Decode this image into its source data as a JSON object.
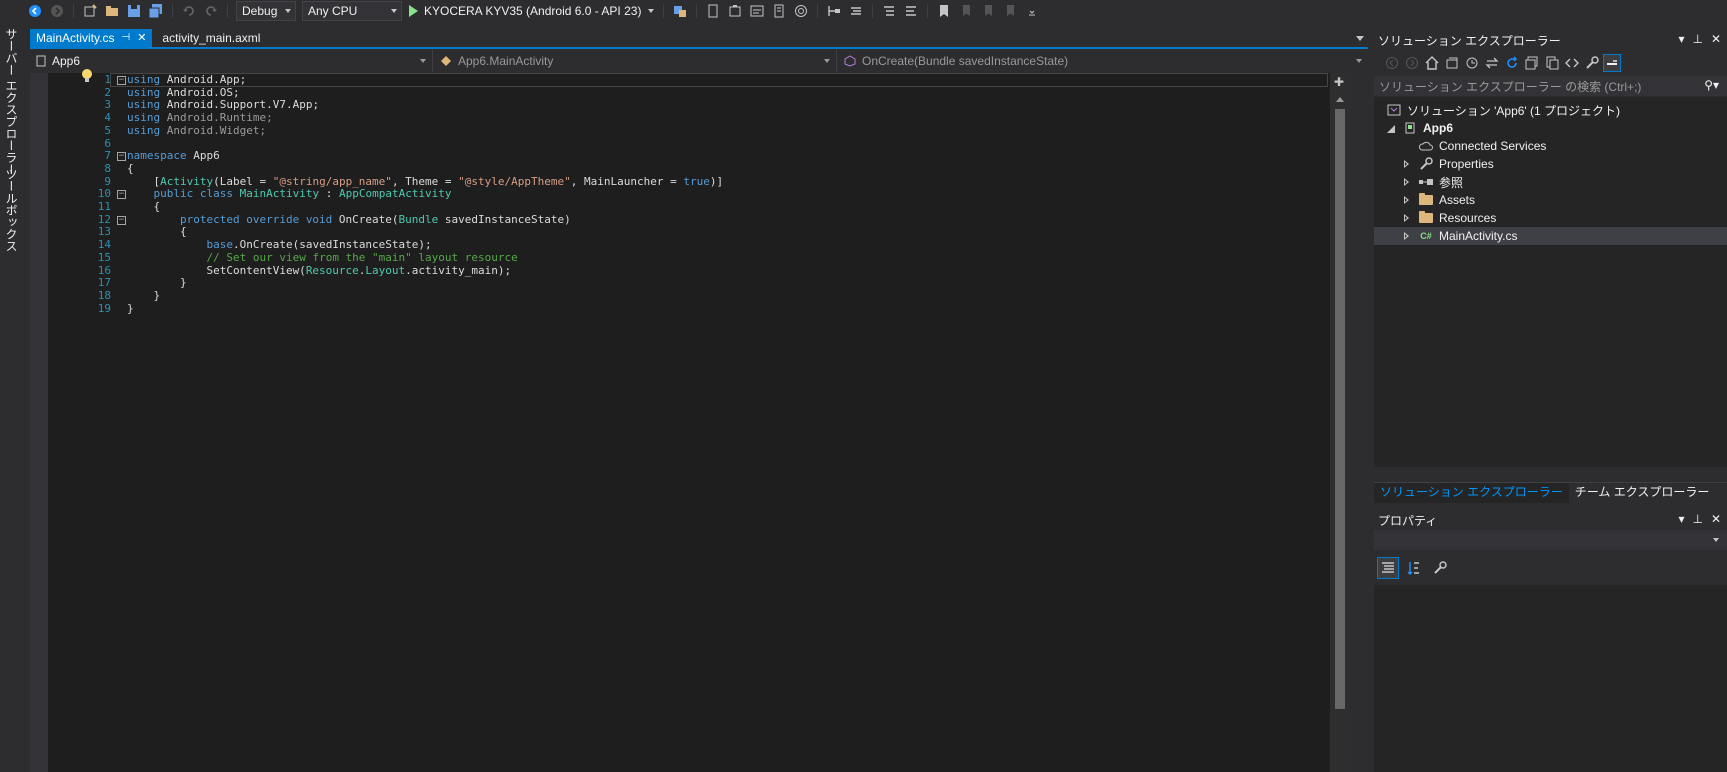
{
  "toolbar": {
    "configuration": "Debug",
    "platform": "Any CPU",
    "run_target": "KYOCERA KYV35 (Android 6.0 - API 23)"
  },
  "left_strip": {
    "server_explorer": "サーバー エクスプローラー",
    "toolbox": "ツールボックス"
  },
  "doc_tabs": {
    "active": "MainActivity.cs",
    "inactive": "activity_main.axml",
    "pin_glyph": "⊣",
    "close_glyph": "✕"
  },
  "nav_bar": {
    "project": "App6",
    "class": "App6.MainActivity",
    "member": "OnCreate(Bundle savedInstanceState)"
  },
  "code": {
    "lines": [
      {
        "n": "1",
        "fold": "−"
      },
      {
        "n": "2"
      },
      {
        "n": "3"
      },
      {
        "n": "4"
      },
      {
        "n": "5"
      },
      {
        "n": "6"
      },
      {
        "n": "7",
        "fold": "−"
      },
      {
        "n": "8"
      },
      {
        "n": "9"
      },
      {
        "n": "10",
        "fold": "−"
      },
      {
        "n": "11"
      },
      {
        "n": "12",
        "fold": "−"
      },
      {
        "n": "13"
      },
      {
        "n": "14"
      },
      {
        "n": "15"
      },
      {
        "n": "16"
      },
      {
        "n": "17"
      },
      {
        "n": "18"
      },
      {
        "n": "19"
      }
    ],
    "tokens": {
      "l1": [
        [
          "kw",
          "using"
        ],
        [
          "",
          " Android.App;"
        ]
      ],
      "l2": [
        [
          "kw",
          "using"
        ],
        [
          "",
          " Android.OS;"
        ]
      ],
      "l3": [
        [
          "kw",
          "using"
        ],
        [
          "",
          " Android.Support.V7.App;"
        ]
      ],
      "l4": [
        [
          "kw",
          "using"
        ],
        [
          "dim",
          " Android.Runtime;"
        ]
      ],
      "l5": [
        [
          "kw",
          "using"
        ],
        [
          "dim",
          " Android.Widget;"
        ]
      ],
      "l7": [
        [
          "kw",
          "namespace"
        ],
        [
          "",
          " App6"
        ]
      ],
      "l8": [
        [
          "",
          "{"
        ]
      ],
      "l9": [
        [
          "",
          "    ["
        ],
        [
          "ty",
          "Activity"
        ],
        [
          "",
          "(Label = "
        ],
        [
          "st",
          "\"@string/app_name\""
        ],
        [
          "",
          ", Theme = "
        ],
        [
          "st",
          "\"@style/AppTheme\""
        ],
        [
          "",
          ", MainLauncher = "
        ],
        [
          "kw",
          "true"
        ],
        [
          "",
          ")]"
        ]
      ],
      "l10": [
        [
          "",
          "    "
        ],
        [
          "kw",
          "public class"
        ],
        [
          "",
          " "
        ],
        [
          "ty",
          "MainActivity"
        ],
        [
          "",
          " : "
        ],
        [
          "ty",
          "AppCompatActivity"
        ]
      ],
      "l11": [
        [
          "",
          "    {"
        ]
      ],
      "l12": [
        [
          "",
          "        "
        ],
        [
          "kw",
          "protected override void"
        ],
        [
          "",
          " OnCreate("
        ],
        [
          "ty",
          "Bundle"
        ],
        [
          "",
          " savedInstanceState)"
        ]
      ],
      "l13": [
        [
          "",
          "        {"
        ]
      ],
      "l14": [
        [
          "",
          "            "
        ],
        [
          "kw",
          "base"
        ],
        [
          "",
          ".OnCreate(savedInstanceState);"
        ]
      ],
      "l15": [
        [
          "",
          "            "
        ],
        [
          "cm",
          "// Set our view from the \"main\" layout resource"
        ]
      ],
      "l16": [
        [
          "",
          "            SetContentView("
        ],
        [
          "ty",
          "Resource"
        ],
        [
          "",
          "."
        ],
        [
          "ty",
          "Layout"
        ],
        [
          "",
          ".activity_main);"
        ]
      ],
      "l17": [
        [
          "",
          "        }"
        ]
      ],
      "l18": [
        [
          "",
          "    }"
        ]
      ],
      "l19": [
        [
          "",
          "}"
        ]
      ]
    }
  },
  "solution_explorer": {
    "title": "ソリューション エクスプローラー",
    "search_placeholder": "ソリューション エクスプローラー の検索 (Ctrl+;)",
    "solution_node": "ソリューション 'App6' (1 プロジェクト)",
    "project_node": "App6",
    "items": [
      "Connected Services",
      "Properties",
      "参照",
      "Assets",
      "Resources",
      "MainActivity.cs"
    ],
    "tab_solution": "ソリューション エクスプローラー",
    "tab_team": "チーム エクスプローラー"
  },
  "properties": {
    "title": "プロパティ"
  },
  "colors": {
    "accent": "#007acc",
    "background": "#1e1e1e",
    "chrome": "#2d2d30",
    "keyword": "#569cd6",
    "type": "#4ec9b0",
    "string": "#d69d85",
    "comment": "#57a64a",
    "line_number": "#2b91af"
  }
}
